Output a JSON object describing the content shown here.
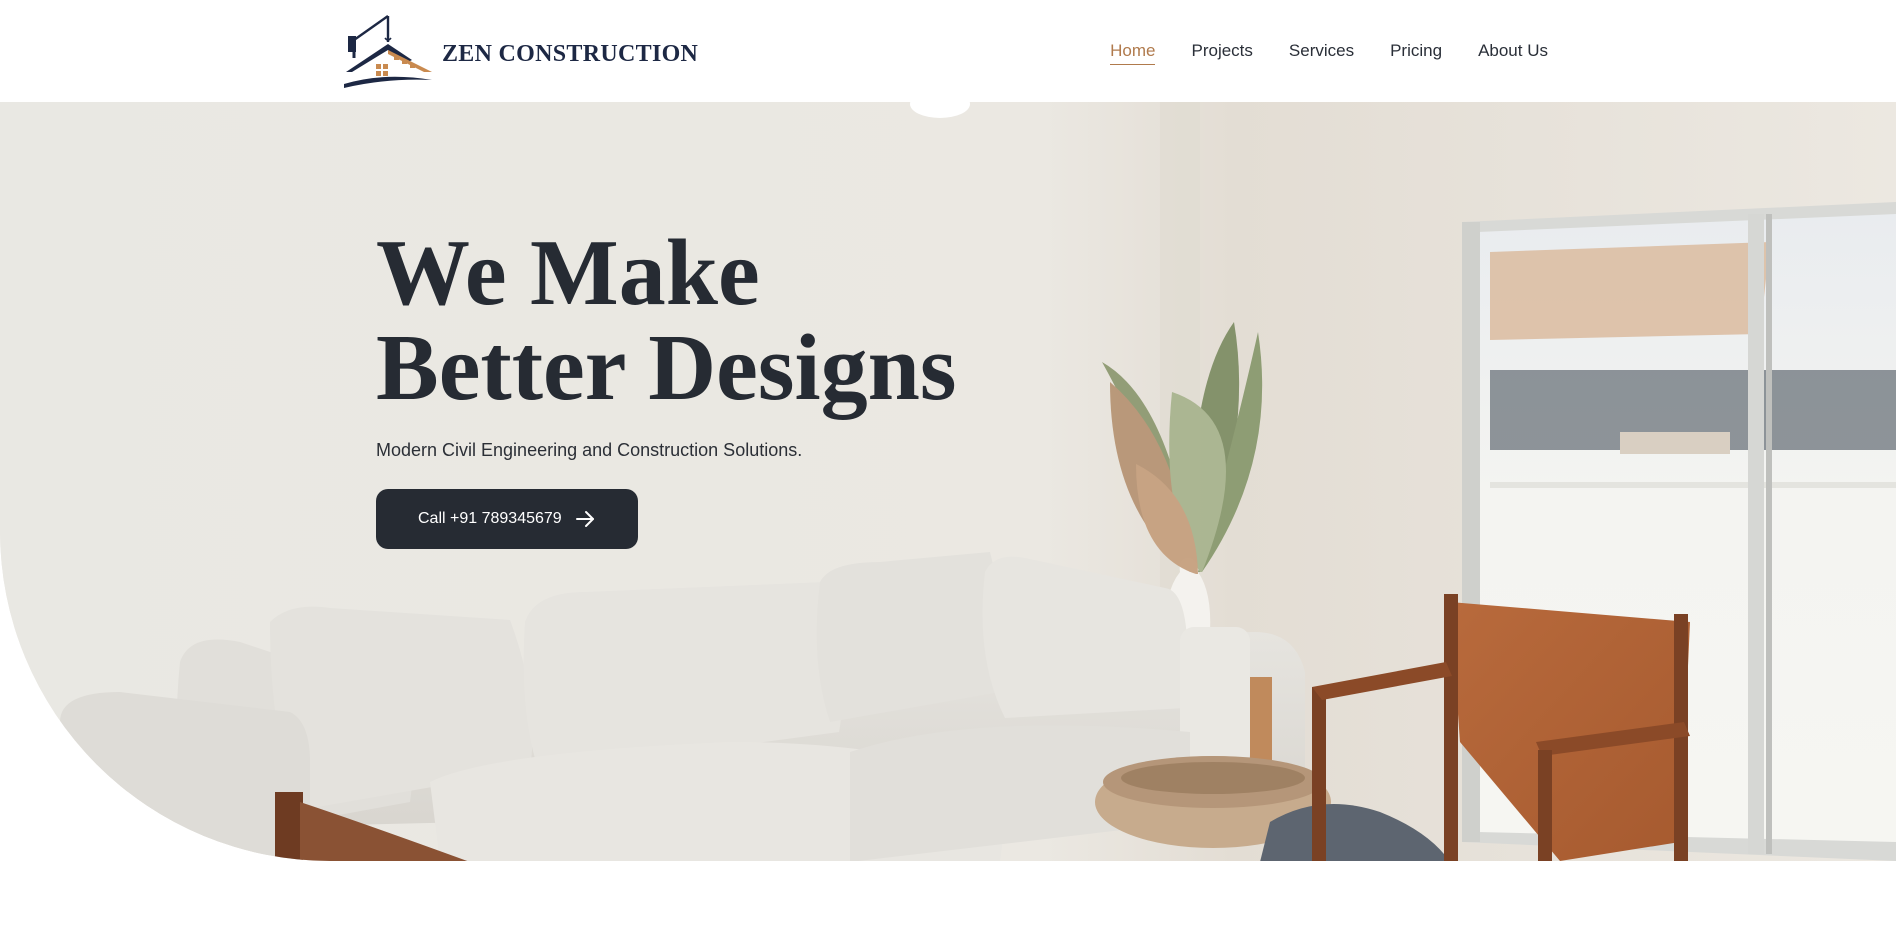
{
  "brand": {
    "name": "ZEN CONSTRUCTION",
    "logo_icon": "house-crane-logo"
  },
  "nav": {
    "items": [
      {
        "label": "Home",
        "active": true
      },
      {
        "label": "Projects",
        "active": false
      },
      {
        "label": "Services",
        "active": false
      },
      {
        "label": "Pricing",
        "active": false
      },
      {
        "label": "About Us",
        "active": false
      }
    ]
  },
  "hero": {
    "title_line1": "We Make",
    "title_line2": "Better Designs",
    "subtitle": "Modern Civil Engineering and Construction Solutions.",
    "cta_label": "Call +91 789345679",
    "cta_icon": "arrow-right-icon"
  },
  "colors": {
    "accent": "#b07a4c",
    "dark": "#262b33",
    "brand_navy": "#1d2844"
  }
}
